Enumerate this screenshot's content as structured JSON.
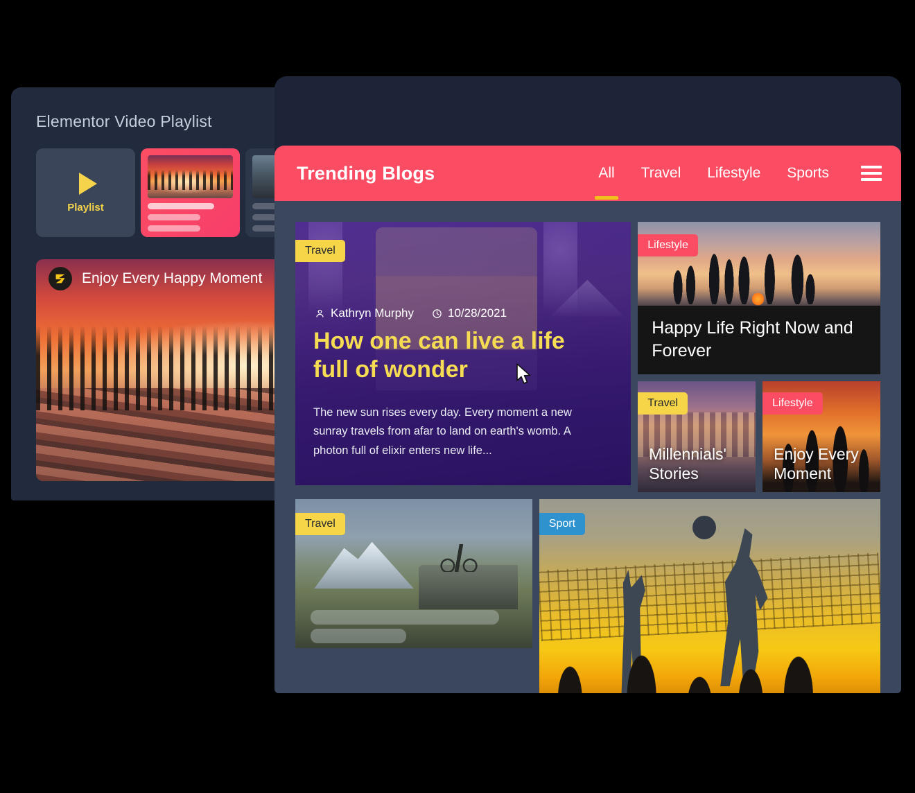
{
  "back_window": {
    "title": "Elementor Video Playlist",
    "playlist_tile_label": "Playlist",
    "video_title": "Enjoy Every Happy Moment",
    "logo_icon": "z-logo-icon",
    "play_icon": "play-icon"
  },
  "front_window": {
    "brand": "Trending Blogs",
    "nav": [
      {
        "label": "All",
        "active": true
      },
      {
        "label": "Travel",
        "active": false
      },
      {
        "label": "Lifestyle",
        "active": false
      },
      {
        "label": "Sports",
        "active": false
      }
    ],
    "menu_icon": "hamburger-icon",
    "featured": {
      "badge": "Travel",
      "author": "Kathryn Murphy",
      "author_icon": "user-icon",
      "date": "10/28/2021",
      "date_icon": "clock-icon",
      "title": "How one can live a life full of wonder",
      "excerpt": "The new sun rises every day. Every moment a new sunray travels from afar to land on earth's womb. A photon full of elixir enters new life..."
    },
    "cards": [
      {
        "badge": "Lifestyle",
        "badge_color": "pink",
        "title": "Happy Life Right Now and Forever"
      },
      {
        "badge": "Travel",
        "badge_color": "yellow",
        "title": "Millennials' Stories"
      },
      {
        "badge": "Lifestyle",
        "badge_color": "pink",
        "title": "Enjoy Every Moment"
      },
      {
        "badge": "Travel",
        "badge_color": "yellow",
        "title": ""
      },
      {
        "badge": "Sport",
        "badge_color": "blue",
        "title": ""
      }
    ]
  },
  "colors": {
    "accent_pink": "#fa4d63",
    "accent_yellow": "#f6d648",
    "accent_blue": "#2e92cf",
    "window_dark": "#1d2438",
    "content_dark": "#3a475c",
    "back_window": "#222b3d",
    "title_yellow": "#f6dc52"
  },
  "cursor": {
    "icon": "arrow-cursor-icon"
  }
}
